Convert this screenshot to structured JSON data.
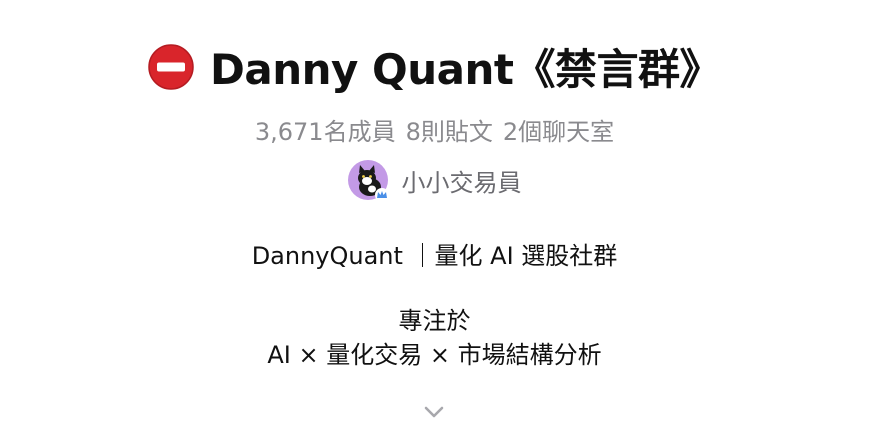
{
  "group": {
    "status_icon": "no-entry-icon",
    "title": "Danny Quant《禁言群》",
    "stats": {
      "members": "3,671名成員",
      "posts": "8則貼文",
      "chatrooms": "2個聊天室"
    },
    "owner": {
      "avatar_icon": "cat-avatar-icon",
      "name": "小小交易員"
    },
    "description": {
      "tagline": "DannyQuant ｜量化 AI 選股社群",
      "focus_heading": "專注於",
      "focus_text": "AI × 量化交易 × 市場結構分析"
    },
    "expand_icon": "chevron-down-icon"
  },
  "colors": {
    "stop_red": "#d9252b",
    "avatar_bg": "#c39ae6",
    "muted_text": "#8a8a8e"
  }
}
